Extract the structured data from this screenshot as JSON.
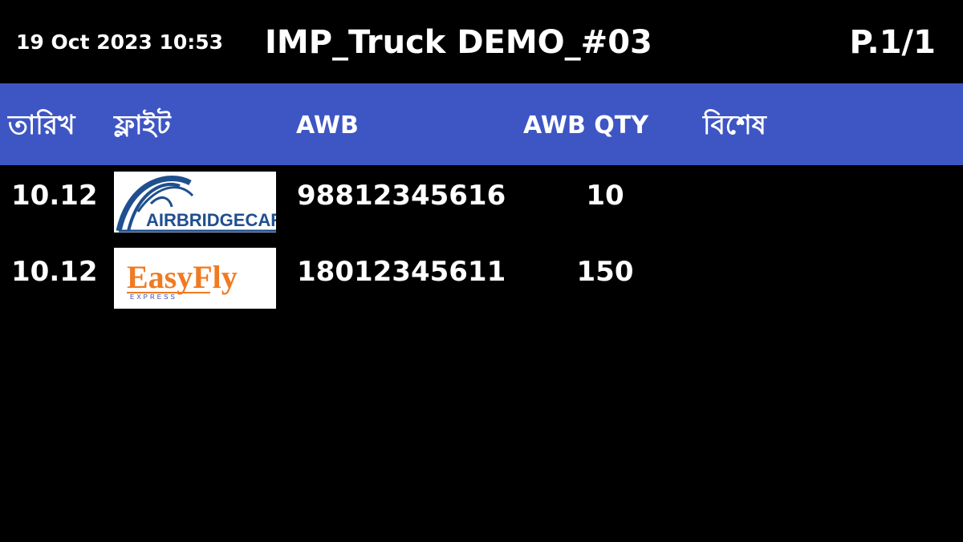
{
  "header_bar": {
    "datetime": "19 Oct 2023 10:53",
    "title": "IMP_Truck DEMO_#03",
    "page": "P.1/1"
  },
  "columns": {
    "date": "তারিখ",
    "flight": "ফ্লাইট",
    "awb": "AWB",
    "awb_qty": "AWB QTY",
    "remarks": "বিশেষ"
  },
  "rows": [
    {
      "date": "10.12",
      "airline": {
        "name": "AirBridgeCargo",
        "logo_text": "AIRBRIDGECARGO",
        "icon": "airbridgecargo-logo"
      },
      "awb": "98812345616",
      "qty": "10",
      "remarks": ""
    },
    {
      "date": "10.12",
      "airline": {
        "name": "EasyFly Express",
        "logo_text": "EasyFly",
        "logo_sub": "EXPRESS",
        "icon": "easyfly-logo"
      },
      "awb": "18012345611",
      "qty": "150",
      "remarks": ""
    }
  ],
  "colors": {
    "background": "#000000",
    "header_band": "#3e56c4",
    "text": "#ffffff",
    "abc_blue": "#1f4f8f",
    "easyfly_orange": "#f07a22"
  }
}
